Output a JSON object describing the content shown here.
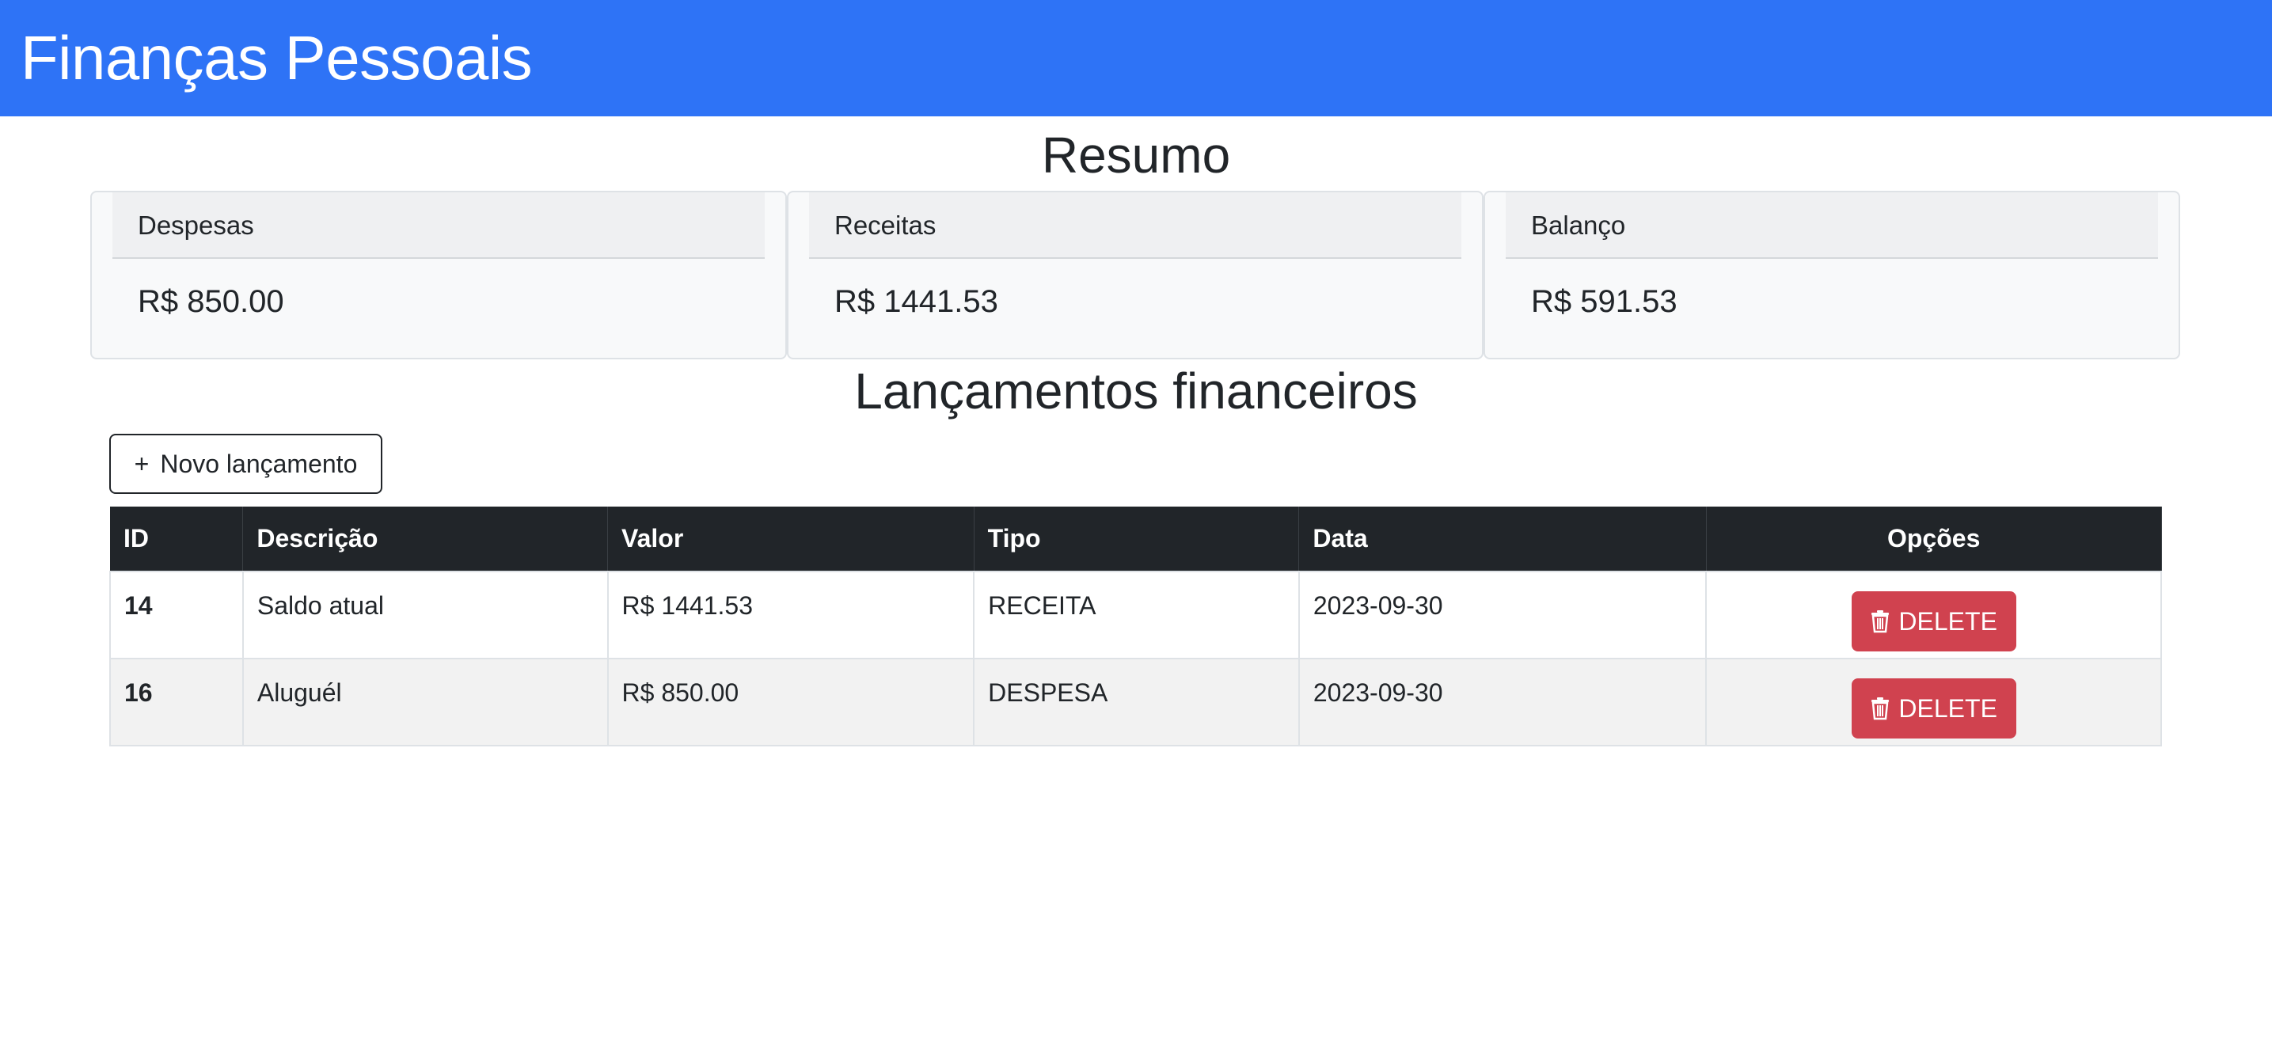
{
  "app": {
    "title": "Finanças Pessoais"
  },
  "summary": {
    "title": "Resumo",
    "cards": [
      {
        "label": "Despesas",
        "value": "R$ 850.00"
      },
      {
        "label": "Receitas",
        "value": "R$ 1441.53"
      },
      {
        "label": "Balanço",
        "value": "R$ 591.53"
      }
    ]
  },
  "entries": {
    "title": "Lançamentos financeiros",
    "new_button": {
      "icon": "plus-icon",
      "label": "Novo lançamento"
    },
    "columns": [
      "ID",
      "Descrição",
      "Valor",
      "Tipo",
      "Data",
      "Opções"
    ],
    "rows": [
      {
        "id": "14",
        "description": "Saldo atual",
        "value": "R$ 1441.53",
        "type": "RECEITA",
        "date": "2023-09-30",
        "action": "DELETE"
      },
      {
        "id": "16",
        "description": "Aluguél",
        "value": "R$ 850.00",
        "type": "DESPESA",
        "date": "2023-09-30",
        "action": "DELETE"
      }
    ]
  },
  "colors": {
    "navbar": "#2e73f6",
    "table_header": "#212529",
    "delete_button": "#d0424f"
  }
}
